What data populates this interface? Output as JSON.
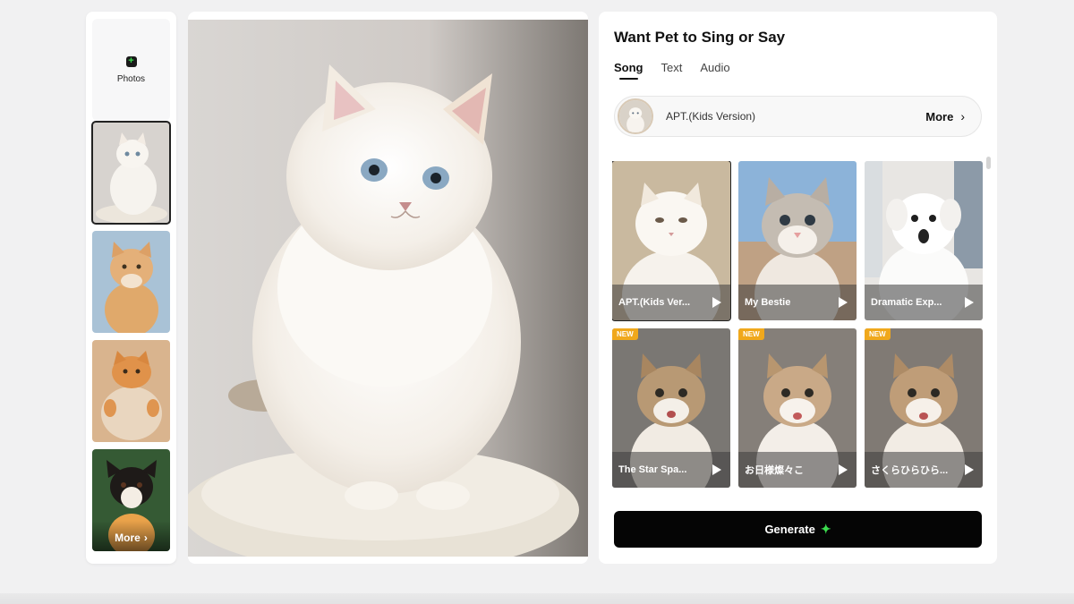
{
  "uploader": {
    "label": "Photos",
    "more_label": "More"
  },
  "panel": {
    "title": "Want Pet to Sing or Say",
    "tabs": [
      {
        "label": "Song",
        "active": true
      },
      {
        "label": "Text",
        "active": false
      },
      {
        "label": "Audio",
        "active": false
      }
    ],
    "current_song": "APT.(Kids Version)",
    "more_label": "More",
    "generate_label": "Generate"
  },
  "songs": [
    {
      "title": "APT.(Kids Ver...",
      "new": false,
      "selected": true
    },
    {
      "title": "My Bestie",
      "new": false,
      "selected": false
    },
    {
      "title": "Dramatic Exp...",
      "new": false,
      "selected": false
    },
    {
      "title": "The Star Spa...",
      "new": true,
      "selected": false
    },
    {
      "title": "お日様燦々こ",
      "new": true,
      "selected": false
    },
    {
      "title": "さくらひらひら...",
      "new": true,
      "selected": false
    }
  ],
  "badge_label": "NEW",
  "colors": {
    "accent_green": "#3bdc4e",
    "new_badge": "#f0a81c",
    "button_bg": "#050505"
  },
  "icons": {
    "upload": "plus-square-icon",
    "more": "chevron-right-icon",
    "play": "play-icon",
    "generate": "sparkle-icon"
  }
}
